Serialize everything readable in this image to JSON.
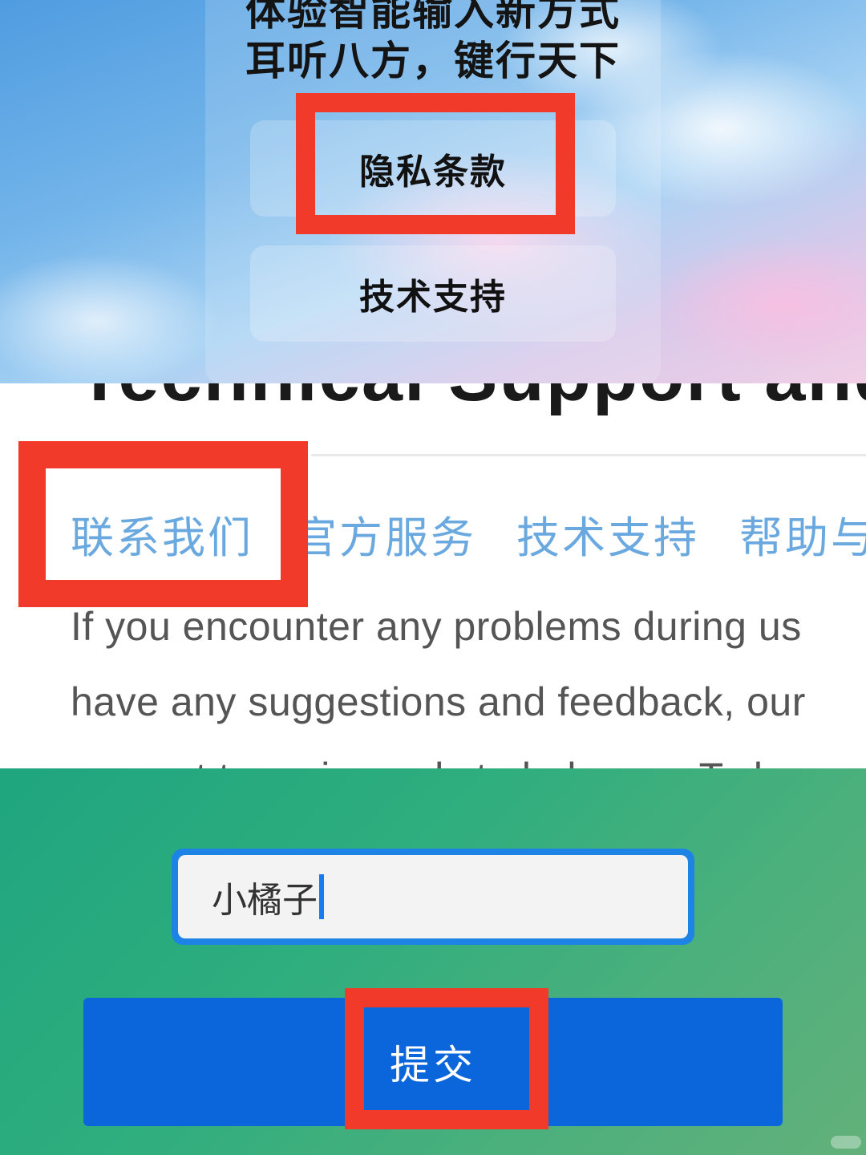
{
  "banner": {
    "slogan_line1": "体验智能输入新方式",
    "slogan_line2": "耳听八方，键行天下",
    "menu": {
      "privacy_label": "隐私条款",
      "support_label": "技术支持"
    }
  },
  "web": {
    "heading": "Technical Support and Cont",
    "tabs": [
      "联系我们",
      "官方服务",
      "技术支持",
      "帮助与反馈"
    ],
    "paragraph_lines": [
      "If you encounter any problems during us",
      "have any suggestions and feedback, our",
      "support team is ready to help you. To be"
    ]
  },
  "form": {
    "name_value": "小橘子",
    "submit_label": "提交"
  },
  "colors": {
    "highlight": "#f23a2b",
    "tab_link": "#6aa8e0",
    "submit_bg": "#0b66dc",
    "input_border": "#1d84e6",
    "form_bg": "#2fae7e"
  }
}
